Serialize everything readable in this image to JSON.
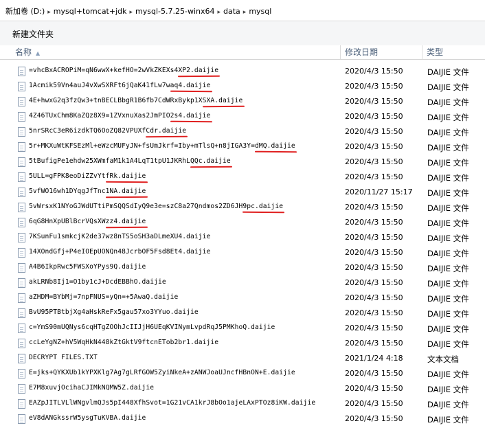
{
  "breadcrumb": {
    "items": [
      "新加卷 (D:)",
      "mysql+tomcat+jdk",
      "mysql-5.7.25-winx64",
      "data",
      "mysql"
    ],
    "separator": "▸"
  },
  "toolbar": {
    "new_folder_label": "新建文件夹"
  },
  "columns": {
    "name": "名称",
    "date": "修改日期",
    "type": "类型"
  },
  "files": [
    {
      "name": "=vhcBxACROPiM=qN6wwX+kefHO=2wVkZKEXs4XP2.daijie",
      "date": "2020/4/3 15:50",
      "type": "DAIJIE 文件"
    },
    {
      "name": "1Acmik59Vn4auJ4vXwSXRFt6jQaK41fLw7waq4.daijie",
      "date": "2020/4/3 15:50",
      "type": "DAIJIE 文件"
    },
    {
      "name": "4E+hwxG2q3fzQw3+tnBECLBbgR1B6fb7CdWRxBykp1XSXA.daijie",
      "date": "2020/4/3 15:50",
      "type": "DAIJIE 文件"
    },
    {
      "name": "4Z46TUxChm8KaZQz8X9=1ZVxnuXas2JmPIO2s4.daijie",
      "date": "2020/4/3 15:50",
      "type": "DAIJIE 文件"
    },
    {
      "name": "5nrSRcC3eR6izdkTQ6OoZQ82VPUXfCdr.daijie",
      "date": "2020/4/3 15:50",
      "type": "DAIJIE 文件"
    },
    {
      "name": "5r+MKXuWtKFSEzMl+eWzcMUFyJN+fsUmJkrf=Iby+mTlsQ+n8jIGA3Y=dMQ.daijie",
      "date": "2020/4/3 15:50",
      "type": "DAIJIE 文件"
    },
    {
      "name": "5tBufigPe1ehdw25XWmfaM1k1A4LqT1tpU1JKRhLQQc.daijie",
      "date": "2020/4/3 15:50",
      "type": "DAIJIE 文件"
    },
    {
      "name": "5ULL=gFPK8eoDiZZvYtfRk.daijie",
      "date": "2020/4/3 15:50",
      "type": "DAIJIE 文件"
    },
    {
      "name": "5vfWO16wh1DYqgJfTnc1NA.daijie",
      "date": "2020/11/27 15:17",
      "type": "DAIJIE 文件"
    },
    {
      "name": "5vWrsxK1NYoGJWdUTtiPmSQQSdIyQ9e3e=szC8a27Qndmos2ZD6JH9pc.daijie",
      "date": "2020/4/3 15:50",
      "type": "DAIJIE 文件"
    },
    {
      "name": "6qG8HnXpUBlBcrVQsXWzz4.daijie",
      "date": "2020/4/3 15:50",
      "type": "DAIJIE 文件"
    },
    {
      "name": "7KSunFu1smkcjK2de37wz8nTS5oSH3aDLmeXU4.daijie",
      "date": "2020/4/3 15:50",
      "type": "DAIJIE 文件"
    },
    {
      "name": "14XOndGfj+P4eIOEpUONQn48JcrbOF5Fsd8Et4.daijie",
      "date": "2020/4/3 15:50",
      "type": "DAIJIE 文件"
    },
    {
      "name": "A4B6IkpRwc5FWSXoYPys9Q.daijie",
      "date": "2020/4/3 15:50",
      "type": "DAIJIE 文件"
    },
    {
      "name": "akLRNb8Ij1=O1by1cJ+DcdEBBhO.daijie",
      "date": "2020/4/3 15:50",
      "type": "DAIJIE 文件"
    },
    {
      "name": "aZHDM=BYbMj=7npFNUS=yQn=+5AwaQ.daijie",
      "date": "2020/4/3 15:50",
      "type": "DAIJIE 文件"
    },
    {
      "name": "BvU95PTBtbjXg4aHskReFx5gau57xo3YYuo.daijie",
      "date": "2020/4/3 15:50",
      "type": "DAIJIE 文件"
    },
    {
      "name": "c=YmS90mUQNys6cqHTgZOOhJcIIJjH6UEqKVINymLvpdRqJ5PMKhoQ.daijie",
      "date": "2020/4/3 15:50",
      "type": "DAIJIE 文件"
    },
    {
      "name": "ccLeYgNZ+hV5WqHkN448kZtGktV9ftcnETob2br1.daijie",
      "date": "2020/4/3 15:50",
      "type": "DAIJIE 文件"
    },
    {
      "name": "DECRYPT FILES.TXT",
      "date": "2021/1/24 4:18",
      "type": "文本文档"
    },
    {
      "name": "E=jks+QYKXUb1kYPXKlg7Ag7gLRfGOW5ZyiNkeA+zANWJoaUJncfHBnON+E.daijie",
      "date": "2020/4/3 15:50",
      "type": "DAIJIE 文件"
    },
    {
      "name": "E7M8xuvjOcihaCJIMkNQMW5Z.daijie",
      "date": "2020/4/3 15:50",
      "type": "DAIJIE 文件"
    },
    {
      "name": "EAZpJITLVLlWNgvlmQJs5pI448XfhSvot=1G21vCA1krJ8bOo1ajeLAxPTOz8iKW.daijie",
      "date": "2020/4/3 15:50",
      "type": "DAIJIE 文件"
    },
    {
      "name": "eV8dANGkssrW5ysgTuKVBA.daijie",
      "date": "2020/4/3 15:50",
      "type": "DAIJIE 文件"
    }
  ],
  "annotation_color": "#e02020"
}
